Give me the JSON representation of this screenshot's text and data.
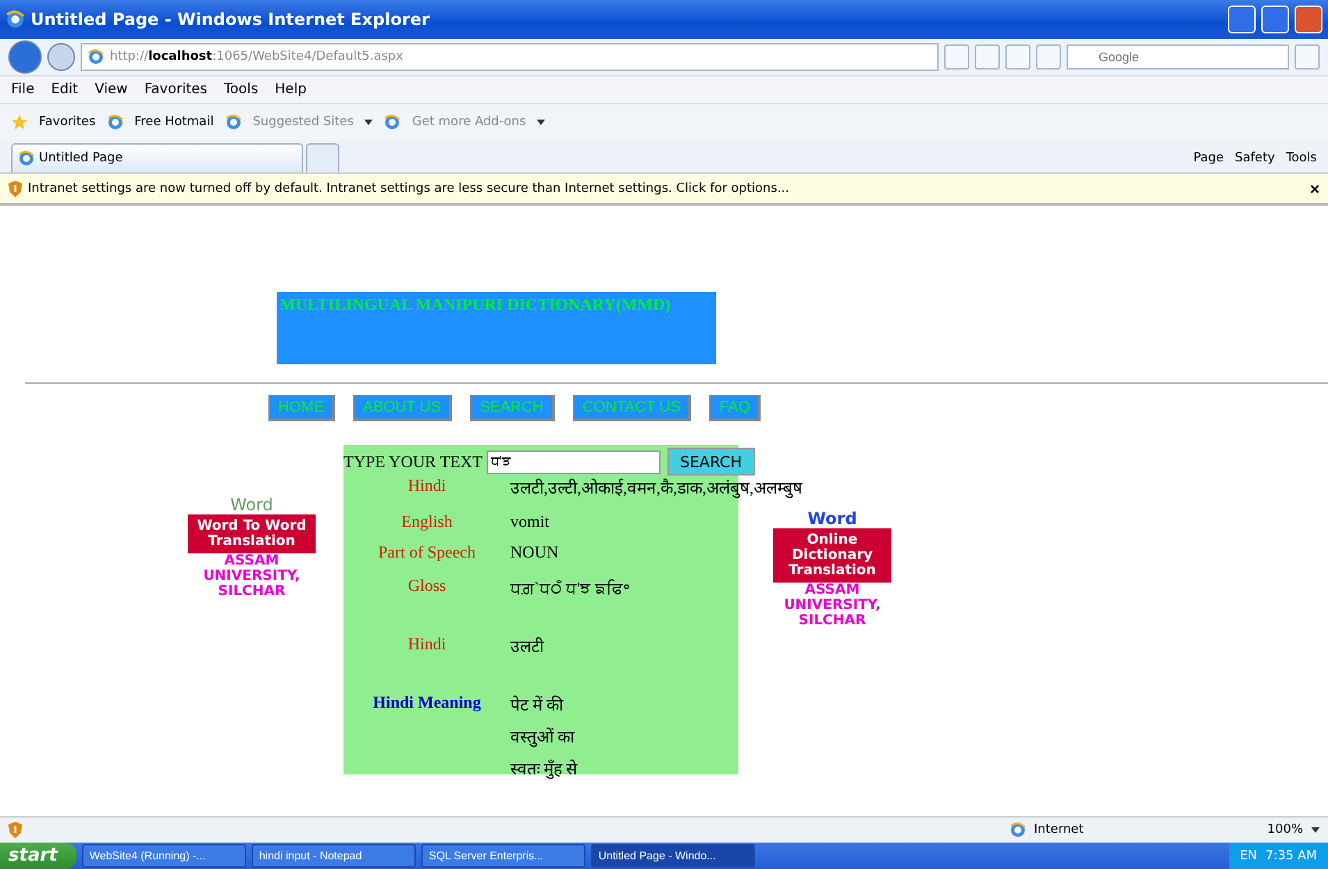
{
  "window": {
    "title": "Untitled Page - Windows Internet Explorer"
  },
  "address_bar": {
    "url": "http://**localhost**:1065/WebSite4/Default5.aspx"
  },
  "search_box": {
    "placeholder": "Google"
  },
  "menu": [
    "File",
    "Edit",
    "View",
    "Favorites",
    "Tools",
    "Help"
  ],
  "favorites_bar": {
    "label": "Favorites",
    "links": [
      {
        "label": "Free Hotmail",
        "dropdown": false
      },
      {
        "label": "Suggested Sites",
        "dropdown": true
      },
      {
        "label": "Get more Add-ons",
        "dropdown": true
      }
    ]
  },
  "tabs": [
    {
      "label": "Untitled Page",
      "selected": true
    }
  ],
  "command_bar": [
    "Page",
    "Safety",
    "Tools"
  ],
  "info_bar": {
    "message": "Intranet settings are now turned off by default. Intranet settings are less secure than Internet settings. Click for options...",
    "close": "×"
  },
  "page": {
    "header": {
      "title": "MULTILINGUAL MANIPURI DICTIONARY(MMD)"
    },
    "nav": [
      "HOME",
      "ABOUT US",
      "SEARCH",
      "CONTACT US",
      "FAQ"
    ],
    "search": {
      "label": "TYPE YOUR TEXT",
      "value": "ਧ'ਝ",
      "button": "SEARCH"
    },
    "results": [
      {
        "label": "Hindi",
        "color": "#cc2200",
        "value": "उलटी,उल्टी,ओकाई,वमन,कै,डाक,अलंबुष,अलम्बुष"
      },
      {
        "label": "English",
        "color": "#cc2200",
        "value": "vomit"
      },
      {
        "label": "Part of Speech",
        "color": "#cc2200",
        "value": "NOUN"
      },
      {
        "label": "Gloss",
        "color": "#cc2200",
        "value": "ਧਗ਼`ਧ੦ਁ ਧ'ਝ ਙਫਿ॰"
      },
      {
        "label": "Hindi",
        "color": "#cc2200",
        "value": "उलटी"
      },
      {
        "label": "Hindi Meaning",
        "color": "#0000cc",
        "lines": [
          "पेट में की",
          "वस्तुओं का",
          "स्वतः मुँह से"
        ]
      }
    ]
  },
  "left_panel": {
    "word": "Word",
    "banner": "Word To Word Translation",
    "institution": "ASSAM UNIVERSITY, SILCHAR"
  },
  "right_panel": {
    "word": "Word",
    "banner": "Online Dictionary Translation",
    "institution": "ASSAM UNIVERSITY, SILCHAR"
  },
  "status_bar": {
    "zone": "Internet",
    "zoom": "100%"
  },
  "taskbar": {
    "start": "start",
    "tasks": [
      {
        "label": "WebSite4 (Running) -...",
        "selected": false
      },
      {
        "label": "hindi input - Notepad",
        "selected": false
      },
      {
        "label": "SQL Server Enterpris...",
        "selected": false
      },
      {
        "label": "Untitled Page - Windo...",
        "selected": true
      }
    ],
    "language": "EN",
    "clock": "7:35 AM"
  }
}
